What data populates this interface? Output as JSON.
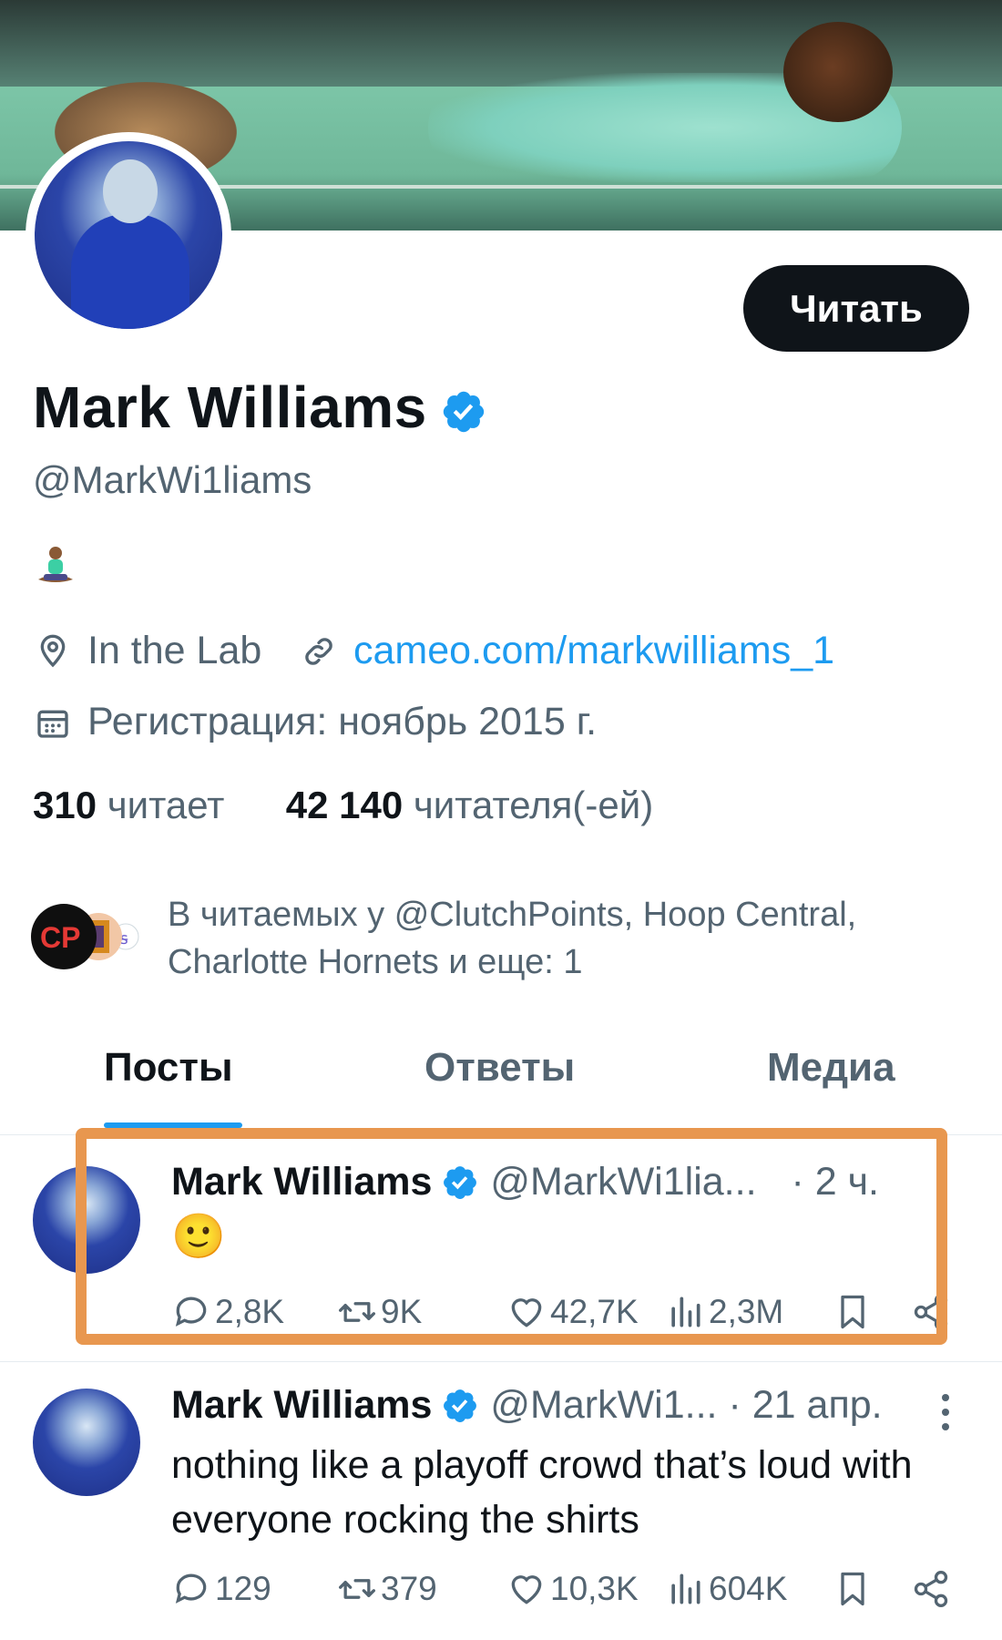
{
  "profile": {
    "name": "Mark Williams",
    "handle": "@MarkWi1liams",
    "bio_emoji": "person-in-lotus-position",
    "location": "In the Lab",
    "website": "cameo.com/markwilliams_1",
    "joined": "Регистрация: ноябрь 2015 г.",
    "following_count": "310",
    "following_label": "читает",
    "followers_count": "42 140",
    "followers_label": "читателя(-ей)",
    "followed_by": "В читаемых у @ClutchPoints, Hoop Central, Charlotte Hornets и еще: 1",
    "follow_button": "Читать"
  },
  "tabs": [
    {
      "label": "Посты",
      "active": true
    },
    {
      "label": "Ответы",
      "active": false
    },
    {
      "label": "Медиа",
      "active": false
    }
  ],
  "posts": [
    {
      "name": "Mark Williams",
      "handle": "@MarkWi1lia...",
      "time": "· 2 ч.",
      "text": "🙂",
      "replies": "2,8K",
      "reposts": "9K",
      "likes": "42,7K",
      "views": "2,3M"
    },
    {
      "name": "Mark Williams",
      "handle": "@MarkWi1...",
      "time": "· 21 апр.",
      "text": "nothing like a playoff crowd that’s loud with everyone rocking the shirts",
      "replies": "129",
      "reposts": "379",
      "likes": "10,3K",
      "views": "604K"
    }
  ],
  "colors": {
    "accent": "#1d9bf0",
    "highlight_border": "#e8974f",
    "text_primary": "#0f1419",
    "text_secondary": "#536471"
  }
}
